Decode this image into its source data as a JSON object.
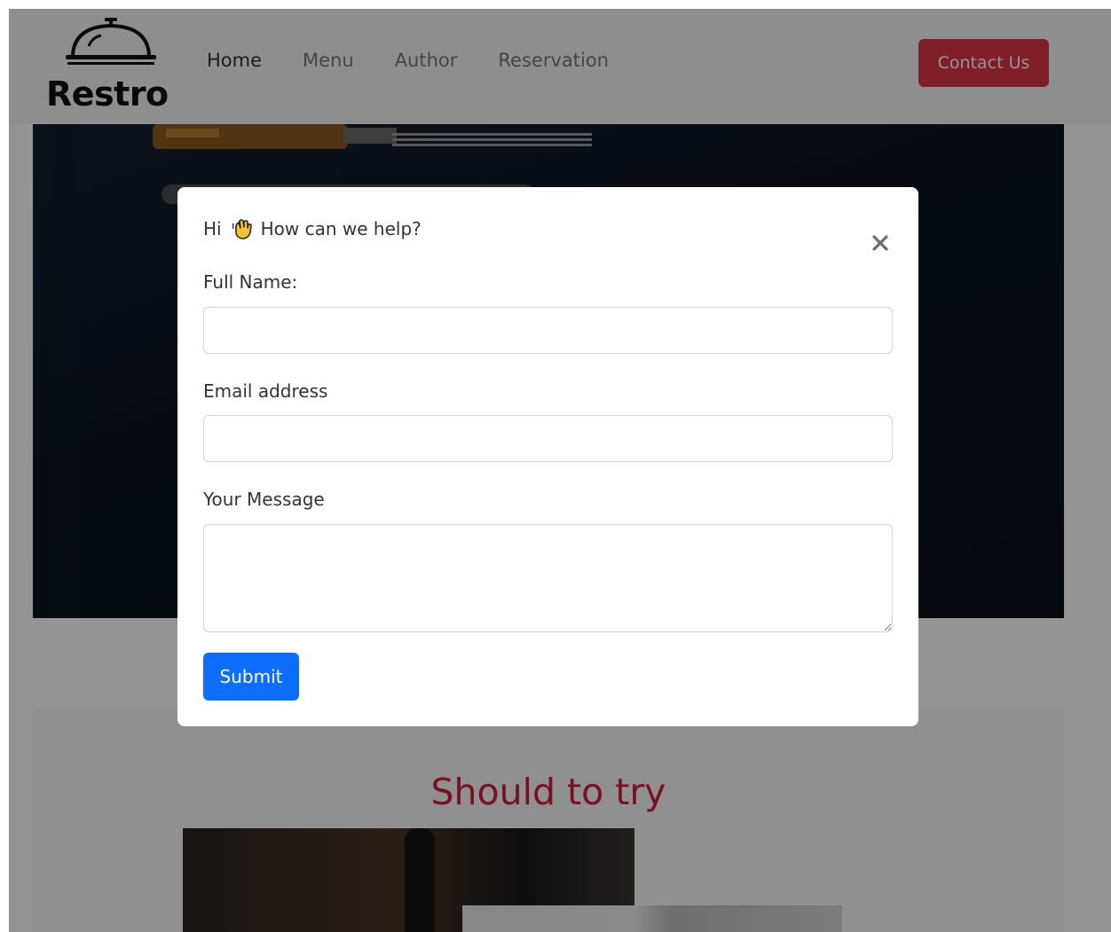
{
  "navbar": {
    "brand": "Restro",
    "links": [
      "Home",
      "Menu",
      "Author",
      "Reservation"
    ],
    "active_link": "Home",
    "contact_button": "Contact Us"
  },
  "section": {
    "title": "Should to try"
  },
  "modal": {
    "greeting_prefix": "Hi",
    "greeting_text": "How can we help?",
    "fields": {
      "full_name_label": "Full Name:",
      "full_name_value": "",
      "email_label": "Email address",
      "email_value": "",
      "message_label": "Your Message",
      "message_value": ""
    },
    "submit_label": "Submit"
  },
  "colors": {
    "accent_red": "#dc3545",
    "primary_blue": "#0d6efd",
    "title_red": "#d21e3a"
  },
  "icons": [
    "cloche-icon",
    "waving-hand-icon",
    "close-icon",
    "resize-handle-icon"
  ]
}
